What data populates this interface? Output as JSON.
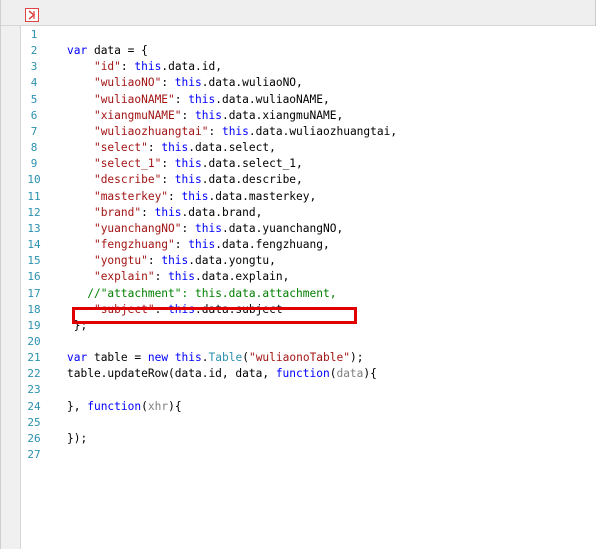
{
  "toolbar": {
    "expand_icon": "collapse-expand-icon",
    "accent": "#dd4444"
  },
  "editor": {
    "colors": {
      "keyword": "#0000ff",
      "string": "#a31515",
      "line_number": "#2b91af",
      "comment": "#008000",
      "param": "#808080",
      "highlight": "#e00000"
    },
    "highlighted_line": 17,
    "lines": [
      {
        "n": "1",
        "tokens": []
      },
      {
        "n": "2",
        "tokens": [
          [
            "kw",
            "var"
          ],
          [
            "p",
            " data = {"
          ]
        ]
      },
      {
        "n": "3",
        "tokens": [
          [
            "p",
            "    "
          ],
          [
            "str",
            "\"id\""
          ],
          [
            "p",
            ": "
          ],
          [
            "kw",
            "this"
          ],
          [
            "p",
            ".data.id,"
          ]
        ]
      },
      {
        "n": "4",
        "tokens": [
          [
            "p",
            "    "
          ],
          [
            "str",
            "\"wuliaoNO\""
          ],
          [
            "p",
            ": "
          ],
          [
            "kw",
            "this"
          ],
          [
            "p",
            ".data.wuliaoNO,"
          ]
        ]
      },
      {
        "n": "5",
        "tokens": [
          [
            "p",
            "    "
          ],
          [
            "str",
            "\"wuliaoNAME\""
          ],
          [
            "p",
            ": "
          ],
          [
            "kw",
            "this"
          ],
          [
            "p",
            ".data.wuliaoNAME,"
          ]
        ]
      },
      {
        "n": "6",
        "tokens": [
          [
            "p",
            "    "
          ],
          [
            "str",
            "\"xiangmuNAME\""
          ],
          [
            "p",
            ": "
          ],
          [
            "kw",
            "this"
          ],
          [
            "p",
            ".data.xiangmuNAME,"
          ]
        ]
      },
      {
        "n": "7",
        "tokens": [
          [
            "p",
            "    "
          ],
          [
            "str",
            "\"wuliaozhuangtai\""
          ],
          [
            "p",
            ": "
          ],
          [
            "kw",
            "this"
          ],
          [
            "p",
            ".data.wuliaozhuangtai,"
          ]
        ]
      },
      {
        "n": "8",
        "tokens": [
          [
            "p",
            "    "
          ],
          [
            "str",
            "\"select\""
          ],
          [
            "p",
            ": "
          ],
          [
            "kw",
            "this"
          ],
          [
            "p",
            ".data.select,"
          ]
        ]
      },
      {
        "n": "9",
        "tokens": [
          [
            "p",
            "    "
          ],
          [
            "str",
            "\"select_1\""
          ],
          [
            "p",
            ": "
          ],
          [
            "kw",
            "this"
          ],
          [
            "p",
            ".data.select_1,"
          ]
        ]
      },
      {
        "n": "10",
        "tokens": [
          [
            "p",
            "    "
          ],
          [
            "str",
            "\"describe\""
          ],
          [
            "p",
            ": "
          ],
          [
            "kw",
            "this"
          ],
          [
            "p",
            ".data.describe,"
          ]
        ]
      },
      {
        "n": "11",
        "tokens": [
          [
            "p",
            "    "
          ],
          [
            "str",
            "\"masterkey\""
          ],
          [
            "p",
            ": "
          ],
          [
            "kw",
            "this"
          ],
          [
            "p",
            ".data.masterkey,"
          ]
        ]
      },
      {
        "n": "12",
        "tokens": [
          [
            "p",
            "    "
          ],
          [
            "str",
            "\"brand\""
          ],
          [
            "p",
            ": "
          ],
          [
            "kw",
            "this"
          ],
          [
            "p",
            ".data.brand,"
          ]
        ]
      },
      {
        "n": "13",
        "tokens": [
          [
            "p",
            "    "
          ],
          [
            "str",
            "\"yuanchangNO\""
          ],
          [
            "p",
            ": "
          ],
          [
            "kw",
            "this"
          ],
          [
            "p",
            ".data.yuanchangNO,"
          ]
        ]
      },
      {
        "n": "14",
        "tokens": [
          [
            "p",
            "    "
          ],
          [
            "str",
            "\"fengzhuang\""
          ],
          [
            "p",
            ": "
          ],
          [
            "kw",
            "this"
          ],
          [
            "p",
            ".data.fengzhuang,"
          ]
        ]
      },
      {
        "n": "15",
        "tokens": [
          [
            "p",
            "    "
          ],
          [
            "str",
            "\"yongtu\""
          ],
          [
            "p",
            ": "
          ],
          [
            "kw",
            "this"
          ],
          [
            "p",
            ".data.yongtu,"
          ]
        ]
      },
      {
        "n": "16",
        "tokens": [
          [
            "p",
            "    "
          ],
          [
            "str",
            "\"explain\""
          ],
          [
            "p",
            ": "
          ],
          [
            "kw",
            "this"
          ],
          [
            "p",
            ".data.explain,"
          ]
        ]
      },
      {
        "n": "17",
        "tokens": [
          [
            "p",
            "   "
          ],
          [
            "cmt",
            "//\"attachment\": this.data.attachment,"
          ]
        ]
      },
      {
        "n": "18",
        "tokens": [
          [
            "p",
            "    "
          ],
          [
            "str",
            "\"subject\""
          ],
          [
            "p",
            ": "
          ],
          [
            "kw",
            "this"
          ],
          [
            "p",
            ".data.subject"
          ]
        ]
      },
      {
        "n": "19",
        "tokens": [
          [
            "p",
            " };"
          ]
        ]
      },
      {
        "n": "20",
        "tokens": []
      },
      {
        "n": "21",
        "tokens": [
          [
            "kw",
            "var"
          ],
          [
            "p",
            " table = "
          ],
          [
            "kw",
            "new"
          ],
          [
            "p",
            " "
          ],
          [
            "kw",
            "this"
          ],
          [
            "p",
            "."
          ],
          [
            "cls",
            "Table"
          ],
          [
            "p",
            "("
          ],
          [
            "str",
            "\"wuliaonoTable\""
          ],
          [
            "p",
            ");"
          ]
        ]
      },
      {
        "n": "22",
        "tokens": [
          [
            "p",
            "table.updateRow(data.id, data, "
          ],
          [
            "kw",
            "function"
          ],
          [
            "p",
            "("
          ],
          [
            "param",
            "data"
          ],
          [
            "p",
            "){"
          ]
        ]
      },
      {
        "n": "23",
        "tokens": []
      },
      {
        "n": "24",
        "tokens": [
          [
            "p",
            "}, "
          ],
          [
            "kw",
            "function"
          ],
          [
            "p",
            "("
          ],
          [
            "param",
            "xhr"
          ],
          [
            "p",
            "){"
          ]
        ]
      },
      {
        "n": "25",
        "tokens": []
      },
      {
        "n": "26",
        "tokens": [
          [
            "p",
            "});"
          ]
        ]
      },
      {
        "n": "27",
        "tokens": []
      }
    ]
  }
}
